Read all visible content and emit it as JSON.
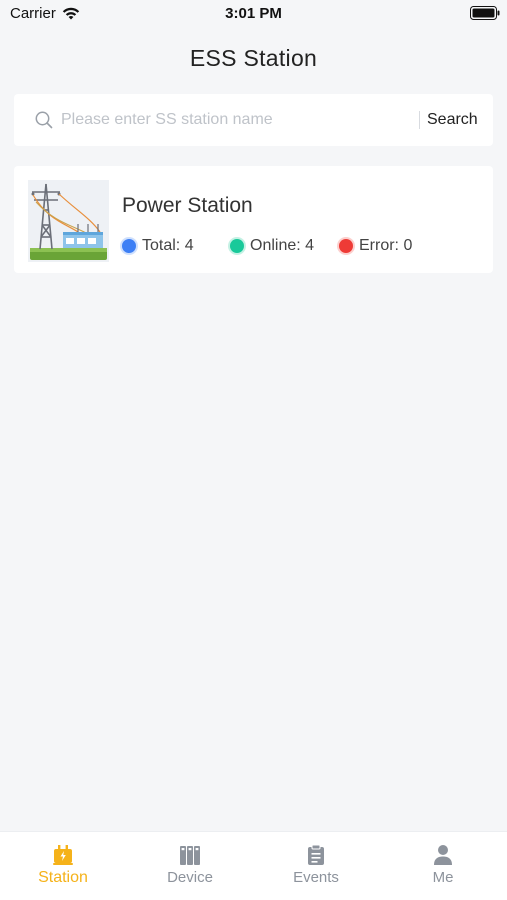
{
  "status_bar": {
    "carrier": "Carrier",
    "time": "3:01 PM",
    "icons": [
      "wifi-icon",
      "battery-icon"
    ]
  },
  "header": {
    "title": "ESS Station"
  },
  "search": {
    "placeholder": "Please enter SS station name",
    "value": "",
    "button_label": "Search",
    "icon": "search-icon"
  },
  "stations": [
    {
      "name": "Power Station",
      "image": "power-station-illustration",
      "stats": {
        "total_label": "Total: 4",
        "online_label": "Online: 4",
        "error_label": "Error: 0"
      },
      "colors": {
        "total": "#3d7ff5",
        "online": "#19c99a",
        "error": "#ee3b36"
      }
    }
  ],
  "tab_bar": {
    "active": "Station",
    "accent_color": "#f5b21a",
    "inactive_color": "#8d939c",
    "tabs": [
      {
        "label": "Station",
        "icon": "station-icon"
      },
      {
        "label": "Device",
        "icon": "device-icon"
      },
      {
        "label": "Events",
        "icon": "events-icon"
      },
      {
        "label": "Me",
        "icon": "person-icon"
      }
    ]
  }
}
